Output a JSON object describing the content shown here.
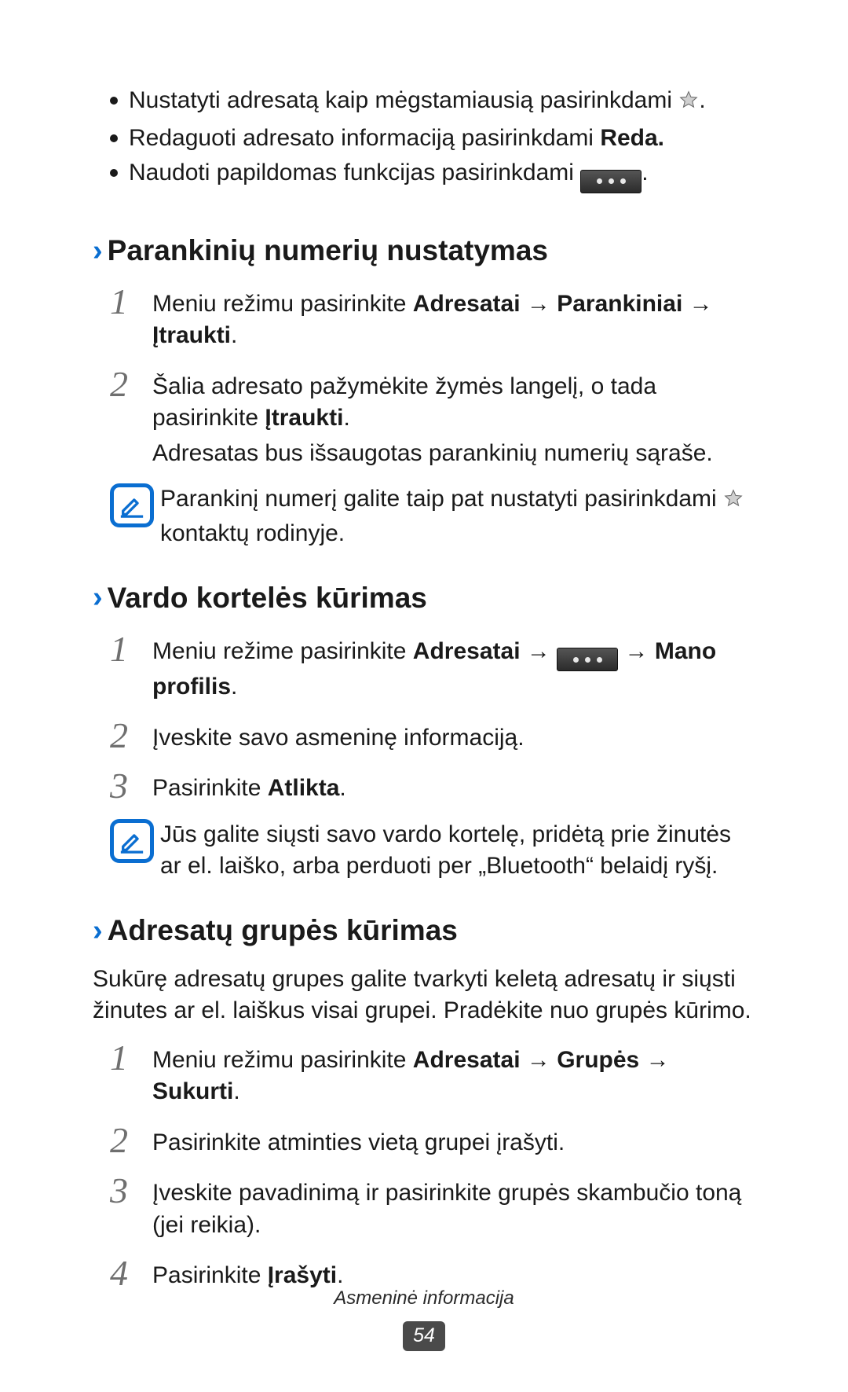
{
  "top_bullets": [
    {
      "pre": "Nustatyti adresatą kaip mėgstamiausią pasirinkdami ",
      "after": ".",
      "has_star": true
    },
    {
      "pre": "Redaguoti adresato informaciją pasirinkdami ",
      "bold": "Reda."
    },
    {
      "pre": "Naudoti papildomas funkcijas pasirinkdami ",
      "after": ".",
      "has_dots": true
    }
  ],
  "sections": [
    {
      "title": "Parankinių numerių nustatymas",
      "steps": [
        {
          "num": "1",
          "parts": [
            {
              "t": "Meniu režimu pasirinkite "
            },
            {
              "t": "Adresatai",
              "b": true
            },
            {
              "t": " → ",
              "arrow": true
            },
            {
              "t": "Parankiniai",
              "b": true
            },
            {
              "t": " → ",
              "arrow": true
            },
            {
              "t": "Įtraukti",
              "b": true
            },
            {
              "t": "."
            }
          ]
        },
        {
          "num": "2",
          "parts": [
            {
              "t": "Šalia adresato pažymėkite žymės langelį, o tada pasirinkite "
            },
            {
              "t": "Įtraukti",
              "b": true
            },
            {
              "t": "."
            }
          ],
          "extra": "Adresatas bus išsaugotas parankinių numerių sąraše."
        }
      ],
      "note": {
        "pre": "Parankinį numerį galite taip pat nustatyti pasirinkdami ",
        "has_star": true,
        "after": " kontaktų rodinyje."
      }
    },
    {
      "title": "Vardo kortelės kūrimas",
      "steps": [
        {
          "num": "1",
          "parts": [
            {
              "t": "Meniu režime pasirinkite "
            },
            {
              "t": "Adresatai",
              "b": true
            },
            {
              "t": " → ",
              "arrow": true
            },
            {
              "dots": true
            },
            {
              "t": " → ",
              "arrow": true
            },
            {
              "t": "Mano profilis",
              "b": true
            },
            {
              "t": "."
            }
          ]
        },
        {
          "num": "2",
          "parts": [
            {
              "t": "Įveskite savo asmeninę informaciją."
            }
          ]
        },
        {
          "num": "3",
          "parts": [
            {
              "t": "Pasirinkite "
            },
            {
              "t": "Atlikta",
              "b": true
            },
            {
              "t": "."
            }
          ]
        }
      ],
      "note": {
        "pre": "Jūs galite siųsti savo vardo kortelę, pridėtą prie žinutės ar el. laiško, arba perduoti per „Bluetooth“ belaidį ryšį."
      }
    },
    {
      "title": "Adresatų grupės kūrimas",
      "intro": "Sukūrę adresatų grupes galite tvarkyti keletą adresatų ir siųsti žinutes ar el. laiškus visai grupei. Pradėkite nuo grupės kūrimo.",
      "steps": [
        {
          "num": "1",
          "parts": [
            {
              "t": "Meniu režimu pasirinkite "
            },
            {
              "t": "Adresatai",
              "b": true
            },
            {
              "t": " → ",
              "arrow": true
            },
            {
              "t": "Grupės",
              "b": true
            },
            {
              "t": " → ",
              "arrow": true
            },
            {
              "t": "Sukurti",
              "b": true
            },
            {
              "t": "."
            }
          ]
        },
        {
          "num": "2",
          "parts": [
            {
              "t": "Pasirinkite atminties vietą grupei įrašyti."
            }
          ]
        },
        {
          "num": "3",
          "parts": [
            {
              "t": "Įveskite pavadinimą ir pasirinkite grupės skambučio toną (jei reikia)."
            }
          ]
        },
        {
          "num": "4",
          "parts": [
            {
              "t": "Pasirinkite "
            },
            {
              "t": "Įrašyti",
              "b": true
            },
            {
              "t": "."
            }
          ]
        }
      ]
    }
  ],
  "footer": {
    "title": "Asmeninė informacija",
    "page": "54"
  }
}
